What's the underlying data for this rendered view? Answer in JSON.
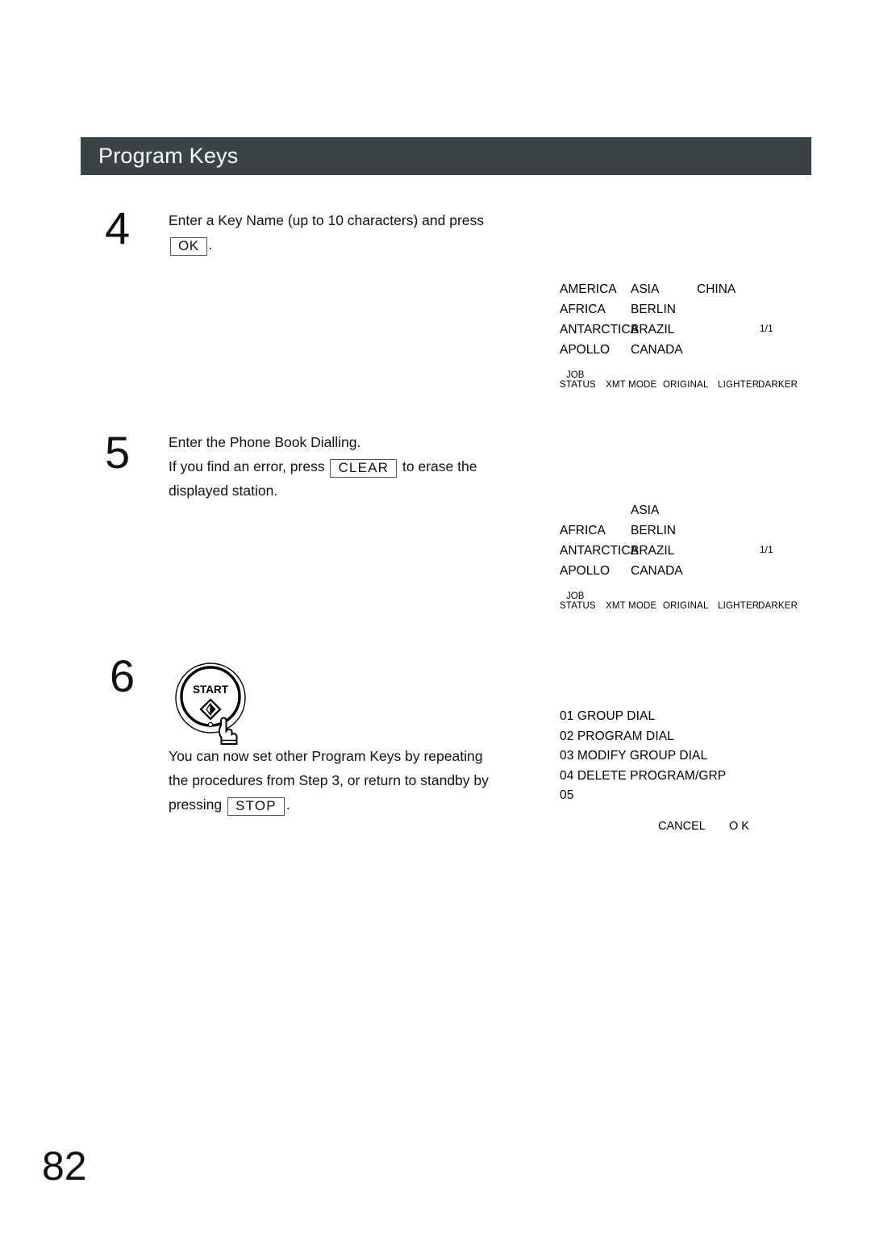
{
  "header": {
    "title": "Program Keys",
    "bar_color": "#3a4446"
  },
  "steps": [
    {
      "number": "4",
      "line1_before": "Enter a Key Name (up to 10 characters) and press",
      "key1": "OK",
      "line2_after": "."
    },
    {
      "number": "5",
      "line1": "Enter the Phone Book Dialling.",
      "line2_before": "If you find an error, press",
      "key1": "CLEAR",
      "line2_after": "to erase the",
      "line3": "displayed station."
    },
    {
      "number": "6",
      "start_button_label": "START",
      "line1": "You can now set other Program Keys by repeating",
      "line2": "the procedures from Step 3, or return to standby by",
      "line3_before": "pressing",
      "key1": "STOP",
      "line3_after": "."
    }
  ],
  "lcd_panels": [
    {
      "id": "panel-step4",
      "rows": [
        {
          "c1": "AMERICA",
          "c2": "ASIA",
          "c3": "CHINA",
          "page": ""
        },
        {
          "c1": "AFRICA",
          "c2": "BERLIN",
          "c3": "",
          "page": ""
        },
        {
          "c1": "ANTARCTICA",
          "c2": "BRAZIL",
          "c3": "",
          "page": "1/1"
        },
        {
          "c1": "APOLLO",
          "c2": "CANADA",
          "c3": "",
          "page": ""
        }
      ],
      "softkeys": {
        "job": "JOB",
        "status": "STATUS",
        "xmt_mode": "XMT MODE",
        "original": "ORIGINAL",
        "lighter": "LIGHTER",
        "darker": "DARKER"
      }
    },
    {
      "id": "panel-step5",
      "rows": [
        {
          "c1": "",
          "c2": "ASIA",
          "c3": "",
          "page": ""
        },
        {
          "c1": "AFRICA",
          "c2": "BERLIN",
          "c3": "",
          "page": ""
        },
        {
          "c1": "ANTARCTICA",
          "c2": "BRAZIL",
          "c3": "",
          "page": "1/1"
        },
        {
          "c1": "APOLLO",
          "c2": "CANADA",
          "c3": "",
          "page": ""
        }
      ],
      "softkeys": {
        "job": "JOB",
        "status": "STATUS",
        "xmt_mode": "XMT MODE",
        "original": "ORIGINAL",
        "lighter": "LIGHTER",
        "darker": "DARKER"
      }
    }
  ],
  "menu_panel": {
    "items": [
      "01 GROUP DIAL",
      "02 PROGRAM DIAL",
      "03 MODIFY GROUP DIAL",
      "04 DELETE PROGRAM/GRP",
      "05"
    ],
    "cancel": "CANCEL",
    "ok": "O K"
  },
  "page_number": "82"
}
